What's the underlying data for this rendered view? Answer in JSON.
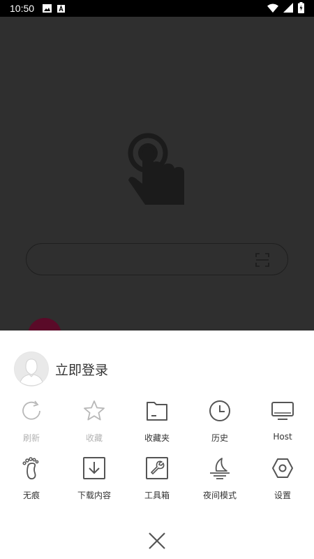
{
  "status_bar": {
    "time": "10:50",
    "icons": [
      "image-icon",
      "a-notification-icon",
      "wifi-icon",
      "signal-icon",
      "battery-icon"
    ]
  },
  "background": {
    "search_placeholder": "",
    "icons": [
      "touch-hand-icon",
      "scan-icon"
    ]
  },
  "menu": {
    "login_label": "立即登录",
    "items": [
      {
        "label": "刷新",
        "icon": "refresh-icon",
        "enabled": false
      },
      {
        "label": "收藏",
        "icon": "star-icon",
        "enabled": false
      },
      {
        "label": "收藏夹",
        "icon": "folder-icon",
        "enabled": true
      },
      {
        "label": "历史",
        "icon": "clock-icon",
        "enabled": true
      },
      {
        "label": "Host",
        "icon": "monitor-icon",
        "enabled": true
      },
      {
        "label": "无痕",
        "icon": "footprint-icon",
        "enabled": true
      },
      {
        "label": "下载内容",
        "icon": "download-icon",
        "enabled": true
      },
      {
        "label": "工具箱",
        "icon": "wrench-icon",
        "enabled": true
      },
      {
        "label": "夜间模式",
        "icon": "night-mode-icon",
        "enabled": true
      },
      {
        "label": "设置",
        "icon": "settings-icon",
        "enabled": true
      }
    ],
    "close_icon": "close-icon"
  },
  "colors": {
    "overlay": "#2f2f2f",
    "sheet": "#ffffff",
    "icon": "#555555",
    "disabled": "#b3b3b3",
    "accent_peek": "#5a0a28"
  }
}
